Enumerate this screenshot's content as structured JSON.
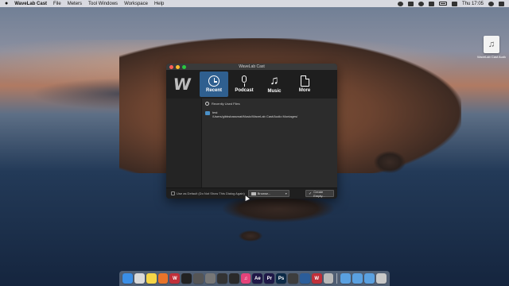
{
  "menubar": {
    "app_name": "WaveLab Cast",
    "items": [
      "File",
      "Meters",
      "Tool Windows",
      "Workspace",
      "Help"
    ],
    "clock": "Thu 17:05"
  },
  "desktop": {
    "file_label": "WaveLab Cast Audio..."
  },
  "window": {
    "title": "WaveLab Cast",
    "tabs": [
      {
        "label": "Recent",
        "icon": "clock-icon",
        "active": true
      },
      {
        "label": "Podcast",
        "icon": "microphone-icon",
        "active": false
      },
      {
        "label": "Music",
        "icon": "music-note-icon",
        "active": false
      },
      {
        "label": "More",
        "icon": "document-icon",
        "active": false
      }
    ],
    "recent_header": "Recently Used Files",
    "recent_items": [
      {
        "name": "test",
        "path": "/Users/gibbsbassmat/Music/WaveLab Cast/Audio Montages/"
      }
    ],
    "default_checkbox_label": "Use as Default (Do Not Show This Dialog Again)",
    "browse_label": "Browse...",
    "create_label": "Create Empty...",
    "accent_color": "#2f5f8f"
  },
  "dock": {
    "apps": [
      {
        "name": "finder",
        "label": "",
        "color": "#3a8ee6"
      },
      {
        "name": "launchpad",
        "label": "",
        "color": "#d9d9d9"
      },
      {
        "name": "notes",
        "label": "",
        "color": "#f5d547"
      },
      {
        "name": "firefox",
        "label": "",
        "color": "#e8742a"
      },
      {
        "name": "wavelab",
        "label": "W",
        "color": "#c0303a"
      },
      {
        "name": "ableton",
        "label": "",
        "color": "#222222"
      },
      {
        "name": "app6",
        "label": "",
        "color": "#555555"
      },
      {
        "name": "app7",
        "label": "",
        "color": "#777777"
      },
      {
        "name": "app8",
        "label": "",
        "color": "#333333"
      },
      {
        "name": "app9",
        "label": "",
        "color": "#2a2a2a"
      },
      {
        "name": "itunes",
        "label": "♫",
        "color": "#e5437a"
      },
      {
        "name": "after-effects",
        "label": "Ae",
        "color": "#1f1847"
      },
      {
        "name": "premiere",
        "label": "Pr",
        "color": "#1e1847"
      },
      {
        "name": "photoshop",
        "label": "Ps",
        "color": "#0c2a47"
      },
      {
        "name": "app14",
        "label": "",
        "color": "#3d3d3d"
      },
      {
        "name": "app15",
        "label": "",
        "color": "#2b5d9a"
      },
      {
        "name": "wavelab-cast",
        "label": "W",
        "color": "#c0303a"
      },
      {
        "name": "app17",
        "label": "",
        "color": "#b8b8b8"
      }
    ],
    "right_items": [
      {
        "name": "folder-1",
        "color": "#5aa0e0"
      },
      {
        "name": "folder-2",
        "color": "#5aa0e0"
      },
      {
        "name": "folder-3",
        "color": "#5aa0e0"
      },
      {
        "name": "trash",
        "color": "#c8c8c8"
      }
    ]
  }
}
